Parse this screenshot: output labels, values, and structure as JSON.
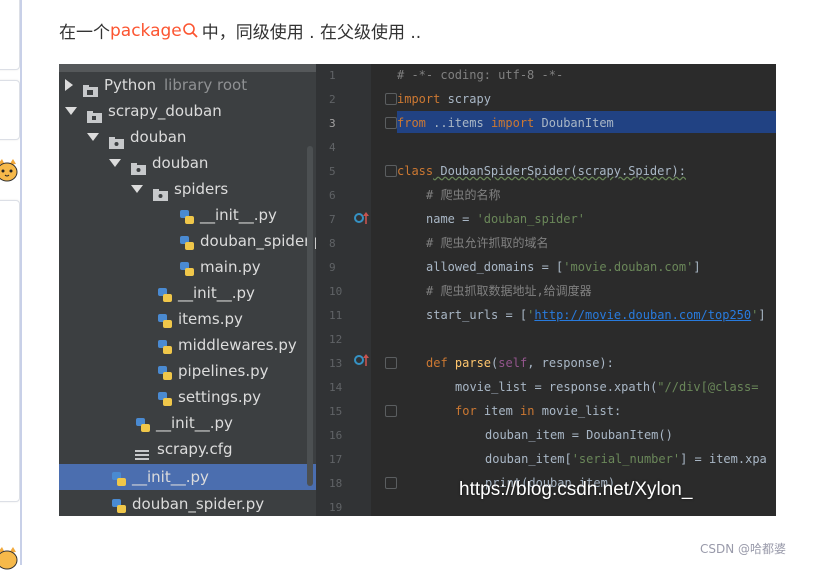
{
  "intro": {
    "before": "在一个",
    "keyword": "package",
    "after": "中，同级使用 . 在父级使用 .."
  },
  "project_tree": [
    {
      "label": "Python",
      "suffix": "library root",
      "kind": "root",
      "state": "collapsed"
    },
    {
      "label": "scrapy_douban",
      "kind": "folder",
      "state": "expanded"
    },
    {
      "label": "douban",
      "kind": "folder",
      "state": "expanded"
    },
    {
      "label": "douban",
      "kind": "folder",
      "state": "expanded"
    },
    {
      "label": "spiders",
      "kind": "folder",
      "state": "expanded"
    },
    {
      "label": "__init__.py",
      "kind": "python-file"
    },
    {
      "label": "douban_spider.py",
      "kind": "python-file"
    },
    {
      "label": "main.py",
      "kind": "python-file"
    },
    {
      "label": "__init__.py",
      "kind": "python-file"
    },
    {
      "label": "items.py",
      "kind": "python-file"
    },
    {
      "label": "middlewares.py",
      "kind": "python-file"
    },
    {
      "label": "pipelines.py",
      "kind": "python-file"
    },
    {
      "label": "settings.py",
      "kind": "python-file"
    },
    {
      "label": "__init__.py",
      "kind": "python-file"
    },
    {
      "label": "scrapy.cfg",
      "kind": "config-file"
    },
    {
      "label": "__init__.py",
      "kind": "python-file",
      "selected": true
    },
    {
      "label": "douban_spider.py",
      "kind": "python-file"
    }
  ],
  "line_numbers": [
    "1",
    "2",
    "3",
    "4",
    "5",
    "6",
    "7",
    "8",
    "9",
    "10",
    "11",
    "12",
    "13",
    "14",
    "15",
    "16",
    "17",
    "18",
    "19"
  ],
  "code_lines": [
    "# -*- coding: utf-8 -*-",
    "import scrapy",
    "from ..items import DoubanItem",
    "",
    "class DoubanSpiderSpider(scrapy.Spider):",
    "    # 爬虫的名称",
    "    name = 'douban_spider'",
    "    # 爬虫允许抓取的域名",
    "    allowed_domains = ['movie.douban.com']",
    "    # 爬虫抓取数据地址,给调度器",
    "    start_urls = ['http://movie.douban.com/top250']",
    "",
    "    def parse(self, response):",
    "        movie_list = response.xpath(\"//div[@class=",
    "        for item in movie_list:",
    "            douban_item = DoubanItem()",
    "            douban_item['serial_number'] = item.xpa",
    "            print(douban_item)",
    ""
  ],
  "code_parts": {
    "l1": "# -*- coding: utf-8 -*-",
    "l2_kw": "import",
    "l2_rest": " scrapy",
    "l3_kw1": "from",
    "l3_mid": " ..items ",
    "l3_kw2": "import",
    "l3_rest": " DoubanItem",
    "l5_kw": "class",
    "l5_rest": " DoubanSpiderSpider(scrapy.Spider):",
    "l6": "# 爬虫的名称",
    "l7_a": "name = ",
    "l7_s": "'douban_spider'",
    "l8": "# 爬虫允许抓取的域名",
    "l9_a": "allowed_domains = [",
    "l9_s": "'movie.douban.com'",
    "l9_b": "]",
    "l10": "# 爬虫抓取数据地址,给调度器",
    "l11_a": "start_urls = [",
    "l11_q1": "'",
    "l11_url": "http://movie.douban.com/top250",
    "l11_q2": "'",
    "l11_b": "]",
    "l13_kw": "def",
    "l13_f": " parse",
    "l13_a": "(",
    "l13_self": "self",
    "l13_b": ", response):",
    "l14_a": "movie_list = response.xpath(",
    "l14_s": "\"//div[@class=",
    "l15_kw1": "for",
    "l15_a": " item ",
    "l15_kw2": "in",
    "l15_b": " movie_list:",
    "l16": "douban_item = DoubanItem()",
    "l17_a": "douban_item[",
    "l17_s": "'serial_number'",
    "l17_b": "] = item.xpa",
    "l18": "print(douban_item)"
  },
  "watermark": "https://blog.csdn.net/Xylon_",
  "credit": "CSDN @哈都婆",
  "colors": {
    "keyword_link": "#fc5531",
    "ide_background": "#2b2b2b",
    "tree_background": "#3c3f41",
    "selection": "#4b6eaf",
    "code_keyword": "#cc7832",
    "code_string": "#6a8759",
    "code_comment": "#808080"
  },
  "icons": [
    "search-icon",
    "folder-icon",
    "python-file-icon",
    "config-file-icon",
    "override-method-icon",
    "fold-marker-icon",
    "cat-mascot-icon"
  ]
}
